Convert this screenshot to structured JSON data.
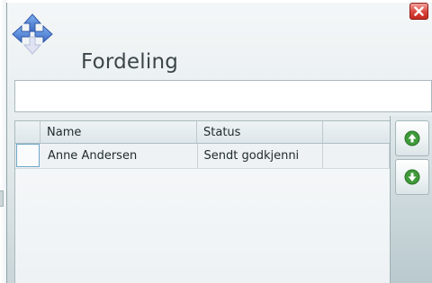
{
  "window": {
    "title": "Fordeling",
    "icons": {
      "app": "move-arrows-icon",
      "close": "close-icon"
    }
  },
  "search": {
    "value": ""
  },
  "table": {
    "columns": [
      "",
      "Name",
      "Status",
      ""
    ],
    "rows": [
      {
        "name": "Anne  Andersen",
        "status": "Sendt godkjenni",
        "extra": ""
      }
    ]
  },
  "side_buttons": [
    {
      "icon": "arrow-up-icon"
    },
    {
      "icon": "arrow-down-icon"
    }
  ],
  "colors": {
    "accent_green": "#3f9a3a",
    "close_red": "#d9453c",
    "icon_blue": "#4a79c8"
  }
}
